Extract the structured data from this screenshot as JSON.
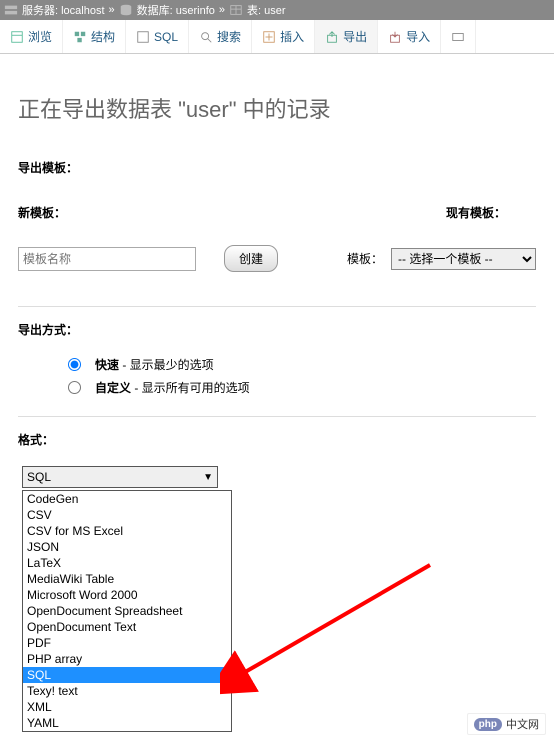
{
  "breadcrumb": {
    "server_label": "服务器: localhost",
    "db_label": "数据库: userinfo",
    "table_label": "表: user",
    "sep": "»"
  },
  "tabs": [
    {
      "label": "浏览"
    },
    {
      "label": "结构"
    },
    {
      "label": "SQL"
    },
    {
      "label": "搜索"
    },
    {
      "label": "插入"
    },
    {
      "label": "导出"
    },
    {
      "label": "导入"
    }
  ],
  "title": "正在导出数据表 \"user\" 中的记录",
  "template_section": {
    "heading": "导出模板：",
    "new_label": "新模板：",
    "existing_label": "现有模板：",
    "name_placeholder": "模板名称",
    "create_btn": "创建",
    "select_label": "模板：",
    "select_placeholder": "-- 选择一个模板 --"
  },
  "method_section": {
    "heading": "导出方式：",
    "quick_strong": "快速",
    "quick_rest": " - 显示最少的选项",
    "custom_strong": "自定义",
    "custom_rest": " - 显示所有可用的选项"
  },
  "format_section": {
    "heading": "格式：",
    "selected": "SQL",
    "options": [
      "CodeGen",
      "CSV",
      "CSV for MS Excel",
      "JSON",
      "LaTeX",
      "MediaWiki Table",
      "Microsoft Word 2000",
      "OpenDocument Spreadsheet",
      "OpenDocument Text",
      "PDF",
      "PHP array",
      "SQL",
      "Texy! text",
      "XML",
      "YAML"
    ]
  },
  "watermark": {
    "logo": "php",
    "text": "中文网"
  }
}
